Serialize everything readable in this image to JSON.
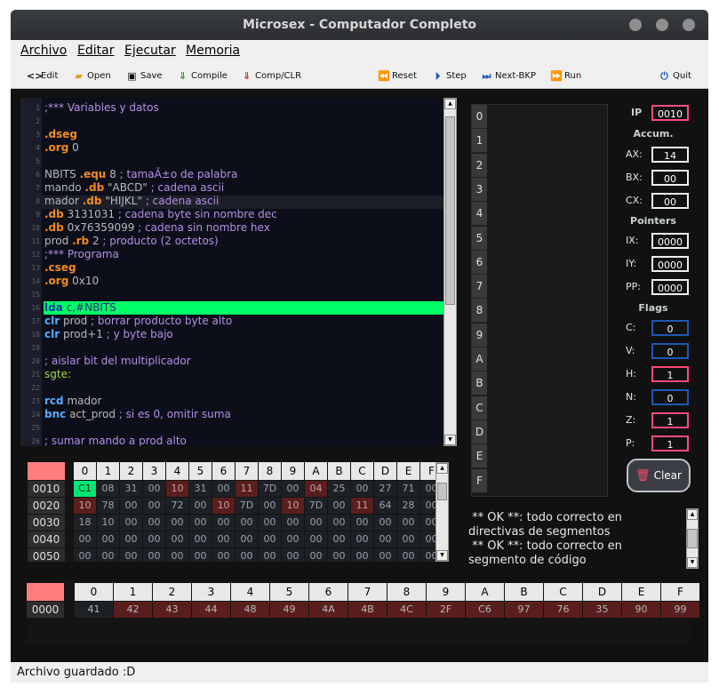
{
  "window": {
    "title": "Microsex - Computador Completo"
  },
  "menu": [
    "Archivo",
    "Editar",
    "Ejecutar",
    "Memoria"
  ],
  "toolbar": {
    "edit": "Edit",
    "open": "Open",
    "save": "Save",
    "compile": "Compile",
    "compclr": "Comp/CLR",
    "reset": "Reset",
    "step": "Step",
    "nextbkp": "Next-BKP",
    "run": "Run",
    "quit": "Quit"
  },
  "editor": {
    "line_numbers": [
      "1",
      "2",
      "3",
      "4",
      "5",
      "6",
      "7",
      "8",
      "9",
      "10",
      "11",
      "12",
      "13",
      "14",
      "15",
      "16",
      "17",
      "18",
      "19",
      "20",
      "21",
      "22",
      "23",
      "24",
      "25",
      "26"
    ],
    "lines": [
      [
        {
          "t": ";*** Variables y datos",
          "c": "cm"
        }
      ],
      [],
      [
        {
          "t": ".dseg",
          "c": "kw"
        }
      ],
      [
        {
          "t": ".org",
          "c": "kw"
        },
        {
          "t": " 0",
          "c": ""
        }
      ],
      [],
      [
        {
          "t": "NBITS ",
          "c": ""
        },
        {
          "t": ".equ",
          "c": "kw"
        },
        {
          "t": " 8 ",
          "c": ""
        },
        {
          "t": "; tamaÃ±o de palabra",
          "c": "cm"
        }
      ],
      [
        {
          "t": "mando ",
          "c": ""
        },
        {
          "t": ".db",
          "c": "kw"
        },
        {
          "t": " \"ABCD\" ",
          "c": ""
        },
        {
          "t": "; cadena ascii",
          "c": "cm"
        }
      ],
      [
        {
          "t": "mador ",
          "c": ""
        },
        {
          "t": ".db",
          "c": "kw"
        },
        {
          "t": " \"HIJKL\" ",
          "c": ""
        },
        {
          "t": "; cadena ascii",
          "c": "cm"
        }
      ],
      [
        {
          "t": ".db",
          "c": "kw"
        },
        {
          "t": " 3131031 ",
          "c": ""
        },
        {
          "t": "; cadena byte sin nombre dec",
          "c": "cm"
        }
      ],
      [
        {
          "t": ".db",
          "c": "kw"
        },
        {
          "t": " 0x76359099 ",
          "c": ""
        },
        {
          "t": "; cadena sin nombre hex",
          "c": "cm"
        }
      ],
      [
        {
          "t": "prod ",
          "c": ""
        },
        {
          "t": ".rb",
          "c": "kw"
        },
        {
          "t": " 2 ",
          "c": ""
        },
        {
          "t": "; producto (2 octetos)",
          "c": "cm"
        }
      ],
      [
        {
          "t": ";*** Programa",
          "c": "cm"
        }
      ],
      [
        {
          "t": ".cseg",
          "c": "kw"
        }
      ],
      [
        {
          "t": ".org",
          "c": "kw"
        },
        {
          "t": " 0x10",
          "c": ""
        }
      ],
      [],
      [
        {
          "t": "lda",
          "c": "op"
        },
        {
          "t": " c,#NBITS",
          "c": "cm"
        }
      ],
      [
        {
          "t": "clr",
          "c": "op"
        },
        {
          "t": " prod ",
          "c": ""
        },
        {
          "t": "; borrar producto byte alto",
          "c": "cm"
        }
      ],
      [
        {
          "t": "clr",
          "c": "op"
        },
        {
          "t": " prod+1 ",
          "c": ""
        },
        {
          "t": "; y byte bajo",
          "c": "cm"
        }
      ],
      [],
      [
        {
          "t": "; aislar bit del multiplicador",
          "c": "cm"
        }
      ],
      [
        {
          "t": "sgte:",
          "c": "lb"
        }
      ],
      [],
      [
        {
          "t": "rcd",
          "c": "op"
        },
        {
          "t": " mador",
          "c": ""
        }
      ],
      [
        {
          "t": "bnc",
          "c": "op"
        },
        {
          "t": " act_prod ",
          "c": ""
        },
        {
          "t": "; si es 0, omitir suma",
          "c": "cm"
        }
      ],
      [],
      [
        {
          "t": "; sumar mando a prod alto",
          "c": "cm"
        }
      ]
    ]
  },
  "memory": {
    "headers": [
      "0",
      "1",
      "2",
      "3",
      "4",
      "5",
      "6",
      "7",
      "8",
      "9",
      "A",
      "B",
      "C",
      "D",
      "E",
      "F"
    ],
    "rows": [
      {
        "addr": "0010",
        "cells": [
          "C1",
          "08",
          "31",
          "00",
          "10",
          "31",
          "00",
          "11",
          "7D",
          "00",
          "04",
          "25",
          "00",
          "27",
          "71",
          "00"
        ],
        "hl": [
          4,
          7,
          10
        ],
        "cur": 0
      },
      {
        "addr": "0020",
        "cells": [
          "10",
          "78",
          "00",
          "00",
          "72",
          "00",
          "10",
          "7D",
          "00",
          "10",
          "7D",
          "00",
          "11",
          "64",
          "28",
          "00"
        ],
        "hl": [
          0,
          6,
          9,
          12
        ],
        "cur": -1
      },
      {
        "addr": "0030",
        "cells": [
          "18",
          "10",
          "00",
          "00",
          "00",
          "00",
          "00",
          "00",
          "00",
          "00",
          "00",
          "00",
          "00",
          "00",
          "00",
          "00"
        ],
        "hl": [],
        "cur": -1
      },
      {
        "addr": "0040",
        "cells": [
          "00",
          "00",
          "00",
          "00",
          "00",
          "00",
          "00",
          "00",
          "00",
          "00",
          "00",
          "00",
          "00",
          "00",
          "00",
          "00"
        ],
        "hl": [],
        "cur": -1
      },
      {
        "addr": "0050",
        "cells": [
          "00",
          "00",
          "00",
          "00",
          "00",
          "00",
          "00",
          "00",
          "00",
          "00",
          "00",
          "00",
          "00",
          "00",
          "00",
          "00"
        ],
        "hl": [],
        "cur": -1
      }
    ]
  },
  "stack_labels": [
    "0",
    "1",
    "2",
    "3",
    "4",
    "5",
    "6",
    "7",
    "8",
    "9",
    "A",
    "B",
    "C",
    "D",
    "E",
    "F"
  ],
  "registers": {
    "ip_label": "IP",
    "ip": "0010",
    "accum_title": "Accum.",
    "accum": [
      {
        "l": "AX:",
        "v": "14"
      },
      {
        "l": "BX:",
        "v": "00"
      },
      {
        "l": "CX:",
        "v": "00"
      }
    ],
    "pointers_title": "Pointers",
    "pointers": [
      {
        "l": "IX:",
        "v": "0000"
      },
      {
        "l": "IY:",
        "v": "0000"
      },
      {
        "l": "PP:",
        "v": "0000"
      }
    ],
    "flags_title": "Flags",
    "flags": [
      {
        "l": "C:",
        "v": "0",
        "s": "blue"
      },
      {
        "l": "V:",
        "v": "0",
        "s": "blue"
      },
      {
        "l": "H:",
        "v": "1",
        "s": "pink"
      },
      {
        "l": "N:",
        "v": "0",
        "s": "blue"
      },
      {
        "l": "Z:",
        "v": "1",
        "s": "pink"
      },
      {
        "l": "P:",
        "v": "1",
        "s": "pink"
      }
    ]
  },
  "clear_label": "Clear",
  "console": [
    " ** OK **: todo correcto en",
    "directivas de segmentos",
    " ** OK **: todo correcto en",
    "segmento de código"
  ],
  "bottom_memory": {
    "headers": [
      "0",
      "1",
      "2",
      "3",
      "4",
      "5",
      "6",
      "7",
      "8",
      "9",
      "A",
      "B",
      "C",
      "D",
      "E",
      "F"
    ],
    "addr": "0000",
    "cells": [
      "41",
      "42",
      "43",
      "44",
      "48",
      "49",
      "4A",
      "4B",
      "4C",
      "2F",
      "C6",
      "97",
      "76",
      "35",
      "90",
      "99"
    ]
  },
  "status": "Archivo guardado :D",
  "colors": {
    "pink": "#ff4a7a",
    "blue": "#1f57b4",
    "hl": "#5a1e1e",
    "cur": "#00e676",
    "green_line": "#00ff66"
  }
}
